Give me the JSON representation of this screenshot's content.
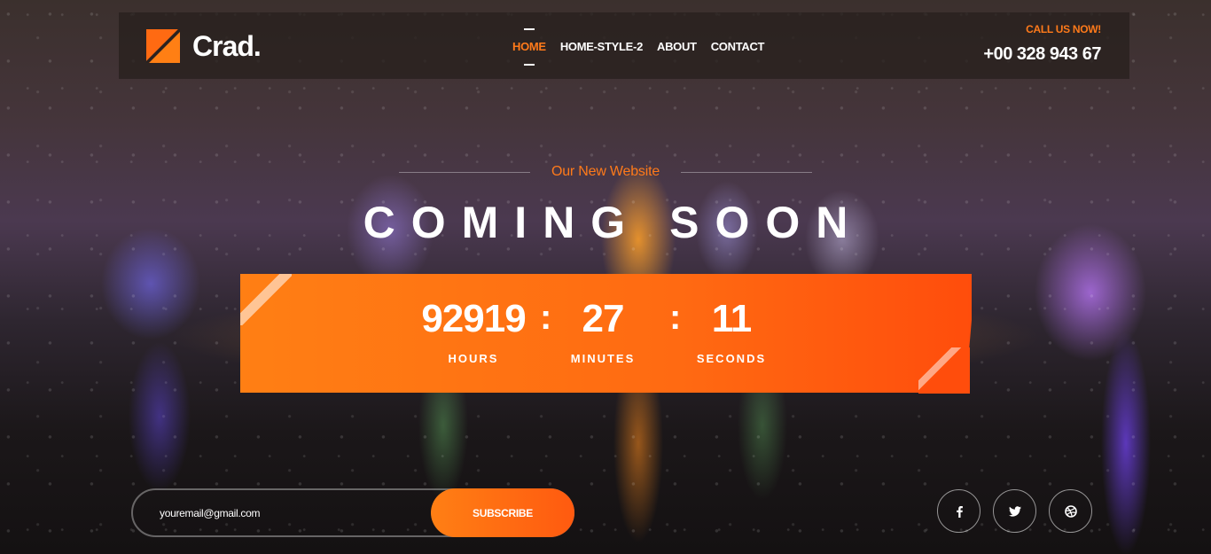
{
  "header": {
    "logo_text": "Crad.",
    "nav": [
      {
        "label": "HOME",
        "active": true
      },
      {
        "label": "HOME-STYLE-2",
        "active": false
      },
      {
        "label": "ABOUT",
        "active": false
      },
      {
        "label": "CONTACT",
        "active": false
      }
    ],
    "call_label": "CALL US NOW!",
    "phone": "+00 328 943 67"
  },
  "hero": {
    "subtitle": "Our New Website",
    "title": "COMING SOON"
  },
  "countdown": {
    "hours": {
      "value": "92919",
      "label": "HOURS"
    },
    "minutes": {
      "value": "27",
      "label": "MINUTES"
    },
    "seconds": {
      "value": "11",
      "label": "SECONDS"
    },
    "separator": ":"
  },
  "subscribe": {
    "placeholder": "youremail@gmail.com",
    "button_label": "SUBSCRIBE"
  },
  "social": [
    {
      "icon": "facebook-icon"
    },
    {
      "icon": "twitter-icon"
    },
    {
      "icon": "dribbble-icon"
    }
  ],
  "colors": {
    "accent": "#ff7a1a",
    "countdown_start": "#ff7f14",
    "countdown_end": "#ff4d0c"
  }
}
